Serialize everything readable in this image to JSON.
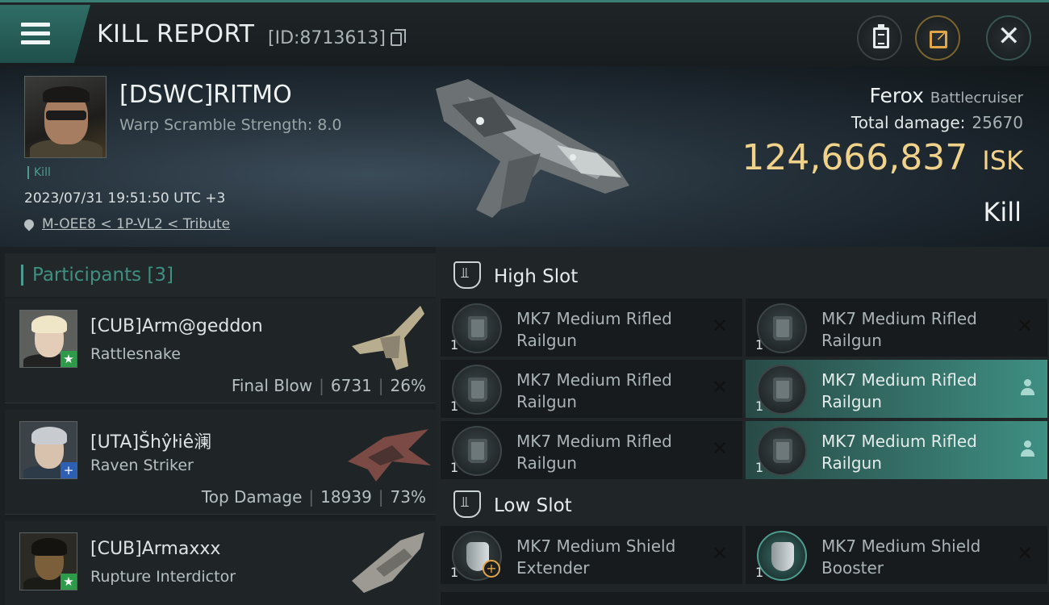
{
  "header": {
    "title": "KILL REPORT",
    "report_id": "[ID:8713613]"
  },
  "victim": {
    "name": "[DSWC]RITMO",
    "warp_scramble": "Warp Scramble Strength: 8.0",
    "tag": "Kill",
    "timestamp": "2023/07/31 19:51:50 UTC +3",
    "location": "M-OEE8 < 1P-VL2 < Tribute",
    "ship_name": "Ferox",
    "ship_class": "Battlecruiser",
    "total_damage_label": "Total damage:",
    "total_damage": "25670",
    "isk_value": "124,666,837",
    "isk_unit": "ISK",
    "result": "Kill"
  },
  "participants": {
    "label": "Participants [3]",
    "items": [
      {
        "name": "[CUB]Arm@geddon",
        "ship": "Rattlesnake",
        "role": "Final Blow",
        "damage": "6731",
        "percent": "26%",
        "badge": "★",
        "badge_color": "#2e9b4a"
      },
      {
        "name": "[UTA]Šhŷŀiê澜",
        "ship": "Raven Striker",
        "role": "Top Damage",
        "damage": "18939",
        "percent": "73%",
        "badge": "+",
        "badge_color": "#2d5fb3"
      },
      {
        "name": "[CUB]Armaxxx",
        "ship": "Rupture Interdictor",
        "role": "",
        "damage": "",
        "percent": "",
        "badge": "★",
        "badge_color": "#2e9b4a"
      }
    ]
  },
  "high_slot": {
    "label": "High Slot",
    "modules": [
      {
        "qty": "1",
        "name": "MK7 Medium Rifled Railgun",
        "state": "destroyed"
      },
      {
        "qty": "1",
        "name": "MK7 Medium Rifled Railgun",
        "state": "destroyed"
      },
      {
        "qty": "1",
        "name": "MK7 Medium Rifled Railgun",
        "state": "destroyed"
      },
      {
        "qty": "1",
        "name": "MK7 Medium Rifled Railgun",
        "state": "dropped"
      },
      {
        "qty": "1",
        "name": "MK7 Medium Rifled Railgun",
        "state": "destroyed"
      },
      {
        "qty": "1",
        "name": "MK7 Medium Rifled Railgun",
        "state": "dropped"
      }
    ]
  },
  "low_slot": {
    "label": "Low Slot",
    "modules": [
      {
        "qty": "1",
        "name": "MK7 Medium Shield Extender",
        "state": "destroyed"
      },
      {
        "qty": "1",
        "name": "MK7 Medium Shield Booster",
        "state": "destroyed"
      }
    ]
  },
  "colors": {
    "accent": "#3f8f83",
    "isk": "#f1d28b",
    "share": "#e2a646"
  }
}
